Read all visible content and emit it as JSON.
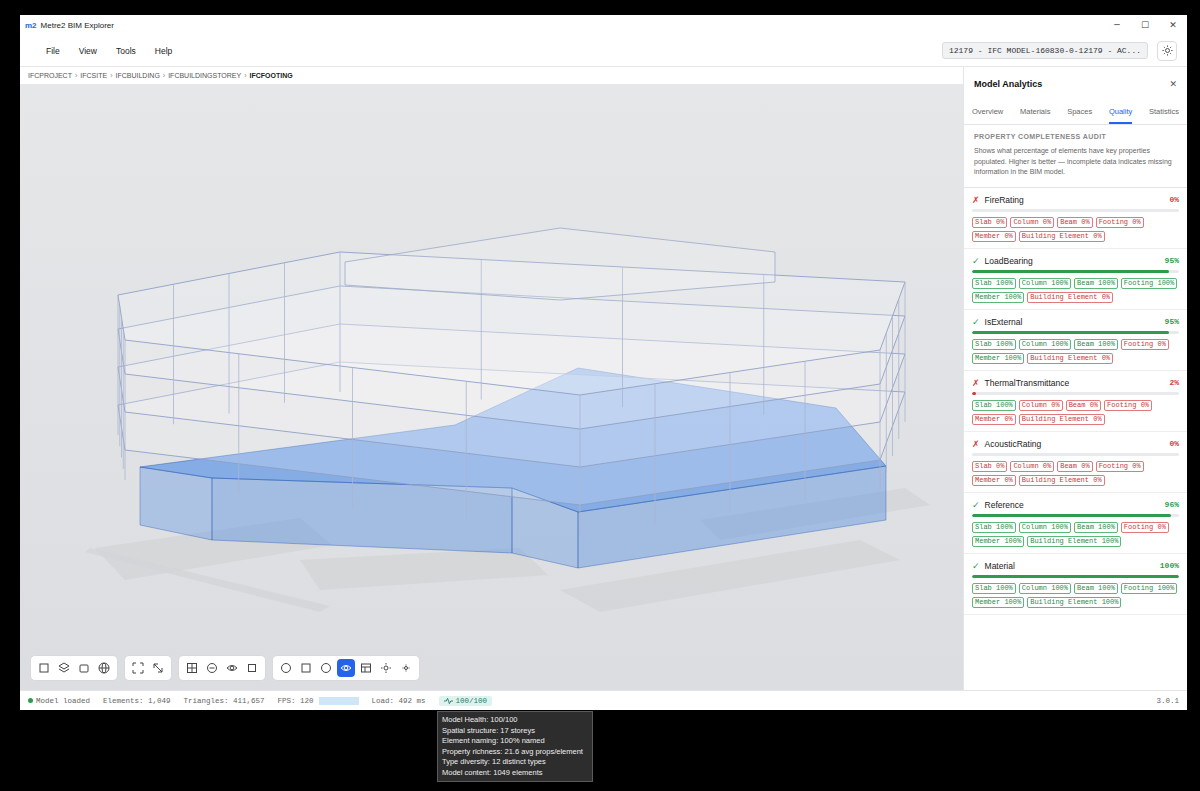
{
  "window": {
    "logo": "m2",
    "title": "Metre2 BIM Explorer",
    "controls": [
      "─",
      "☐",
      "✕"
    ]
  },
  "menu": [
    "File",
    "View",
    "Tools",
    "Help"
  ],
  "model_selector": {
    "value": "12179 - IFC MODEL-160830-0-12179 - AC..."
  },
  "breadcrumb": {
    "items": [
      "IFCPROJECT",
      "IFCSITE",
      "IFCBUILDING",
      "IFCBUILDINGSTOREY",
      "IFCFOOTING"
    ],
    "separator": "›"
  },
  "toolbar": {
    "groups": [
      {
        "tools": [
          {
            "selected": false
          },
          {
            "selected": false
          },
          {
            "selected": false
          },
          {
            "selected": false
          }
        ]
      },
      {
        "tools": [
          {
            "selected": false
          },
          {
            "selected": false
          }
        ]
      },
      {
        "tools": [
          {
            "selected": false
          },
          {
            "selected": false
          },
          {
            "selected": false
          },
          {
            "selected": false
          }
        ]
      },
      {
        "tools": [
          {
            "selected": false
          },
          {
            "selected": false
          },
          {
            "selected": false
          },
          {
            "selected": true
          },
          {
            "selected": false
          },
          {
            "selected": false
          },
          {
            "selected": false
          }
        ]
      }
    ]
  },
  "panel": {
    "title": "Model Analytics",
    "close": "✕",
    "tabs": [
      {
        "label": "Overview",
        "selected": false
      },
      {
        "label": "Materials",
        "selected": false
      },
      {
        "label": "Spaces",
        "selected": false
      },
      {
        "label": "Quality",
        "selected": true
      },
      {
        "label": "Statistics",
        "selected": false
      }
    ],
    "section": {
      "title": "PROPERTY COMPLETENESS AUDIT",
      "description": "Shows what percentage of elements have key properties populated. Higher is better — incomplete data indicates missing information in the BIM model."
    },
    "properties": [
      {
        "name": "FireRating",
        "mark": "✗",
        "pass": false,
        "percent": "0%",
        "level": 0,
        "tags": [
          {
            "label": "Slab 0%",
            "complete": false
          },
          {
            "label": "Column 0%",
            "complete": false
          },
          {
            "label": "Beam 0%",
            "complete": false
          },
          {
            "label": "Footing 0%",
            "complete": false
          },
          {
            "label": "Member 0%",
            "complete": false
          },
          {
            "label": "Building Element 0%",
            "complete": false
          }
        ]
      },
      {
        "name": "LoadBearing",
        "mark": "✓",
        "pass": true,
        "percent": "95%",
        "level": 0.95,
        "tags": [
          {
            "label": "Slab 100%",
            "complete": true
          },
          {
            "label": "Column 100%",
            "complete": true
          },
          {
            "label": "Beam 100%",
            "complete": true
          },
          {
            "label": "Footing 100%",
            "complete": true
          },
          {
            "label": "Member 100%",
            "complete": true
          },
          {
            "label": "Building Element 0%",
            "complete": false
          }
        ]
      },
      {
        "name": "IsExternal",
        "mark": "✓",
        "pass": true,
        "percent": "95%",
        "level": 0.95,
        "tags": [
          {
            "label": "Slab 100%",
            "complete": true
          },
          {
            "label": "Column 100%",
            "complete": true
          },
          {
            "label": "Beam 100%",
            "complete": true
          },
          {
            "label": "Footing 0%",
            "complete": false
          },
          {
            "label": "Member 100%",
            "complete": true
          },
          {
            "label": "Building Element 0%",
            "complete": false
          }
        ]
      },
      {
        "name": "ThermalTransmittance",
        "mark": "✗",
        "pass": false,
        "percent": "2%",
        "level": 0.02,
        "tags": [
          {
            "label": "Slab 100%",
            "complete": true
          },
          {
            "label": "Column 0%",
            "complete": false
          },
          {
            "label": "Beam 0%",
            "complete": false
          },
          {
            "label": "Footing 0%",
            "complete": false
          },
          {
            "label": "Member 0%",
            "complete": false
          },
          {
            "label": "Building Element 0%",
            "complete": false
          }
        ]
      },
      {
        "name": "AcousticRating",
        "mark": "✗",
        "pass": false,
        "percent": "0%",
        "level": 0,
        "tags": [
          {
            "label": "Slab 0%",
            "complete": false
          },
          {
            "label": "Column 0%",
            "complete": false
          },
          {
            "label": "Beam 0%",
            "complete": false
          },
          {
            "label": "Footing 0%",
            "complete": false
          },
          {
            "label": "Member 0%",
            "complete": false
          },
          {
            "label": "Building Element 0%",
            "complete": false
          }
        ]
      },
      {
        "name": "Reference",
        "mark": "✓",
        "pass": true,
        "percent": "96%",
        "level": 0.96,
        "tags": [
          {
            "label": "Slab 100%",
            "complete": true
          },
          {
            "label": "Column 100%",
            "complete": true
          },
          {
            "label": "Beam 100%",
            "complete": true
          },
          {
            "label": "Footing 0%",
            "complete": false
          },
          {
            "label": "Member 100%",
            "complete": true
          },
          {
            "label": "Building Element 100%",
            "complete": true
          }
        ]
      },
      {
        "name": "Material",
        "mark": "✓",
        "pass": true,
        "percent": "100%",
        "level": 1,
        "tags": [
          {
            "label": "Slab 100%",
            "complete": true
          },
          {
            "label": "Column 100%",
            "complete": true
          },
          {
            "label": "Beam 100%",
            "complete": true
          },
          {
            "label": "Footing 100%",
            "complete": true
          },
          {
            "label": "Member 100%",
            "complete": true
          },
          {
            "label": "Building Element 100%",
            "complete": true
          }
        ]
      }
    ]
  },
  "status_bar": {
    "state": "Model loaded",
    "elements": "Elements: 1,049",
    "triangles": "Triangles: 411,657",
    "fps": "FPS: 120",
    "load": "Load: 492 ms",
    "health": "100/100",
    "version": "3.0.1"
  },
  "tooltip": {
    "lines": [
      "Model Health: 100/100",
      "Spatial structure: 17 storeys",
      "Element naming: 100% named",
      "Property richness: 21.6 avg props/element",
      "Type diversity: 12 distinct types",
      "Model content: 1049 elements"
    ]
  }
}
